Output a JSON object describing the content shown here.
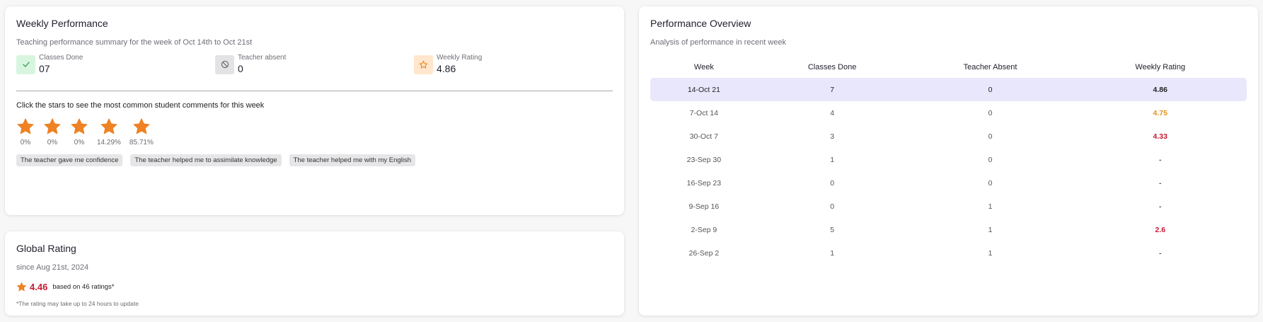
{
  "weekly": {
    "title": "Weekly Performance",
    "subtitle": "Teaching performance summary for the week of Oct 14th to Oct 21st",
    "stats": [
      {
        "label": "Classes Done",
        "value": "07",
        "icon": "check-icon",
        "color": "#3da35a"
      },
      {
        "label": "Teacher absent",
        "value": "0",
        "icon": "absent-icon",
        "color": "#666666"
      },
      {
        "label": "Weekly Rating",
        "value": "4.86",
        "icon": "star-outline-icon",
        "color": "#e3811f"
      }
    ],
    "stars_hint": "Click the stars to see the most common student comments for this week",
    "stars": [
      {
        "percent": "0%"
      },
      {
        "percent": "0%"
      },
      {
        "percent": "0%"
      },
      {
        "percent": "14.29%"
      },
      {
        "percent": "85.71%"
      }
    ],
    "star_color": "#ee8224",
    "comments": [
      "The teacher gave me confidence",
      "The teacher helped me to assimilate knowledge",
      "The teacher helped me with my English"
    ]
  },
  "global": {
    "title": "Global Rating",
    "subtitle": "since Aug 21st, 2024",
    "rating": "4.46",
    "based_on": "based on 46 ratings*",
    "note": "*The rating may take up to 24 hours to update",
    "rating_color": "#c61a35"
  },
  "overview": {
    "title": "Performance Overview",
    "subtitle": "Analysis of performance in recent week",
    "headers": [
      "Week",
      "Classes Done",
      "Teacher Absent",
      "Weekly Rating"
    ],
    "rows": [
      {
        "week": "14-Oct 21",
        "classes": "7",
        "absent": "0",
        "rating": "4.86",
        "rating_color": "#222222"
      },
      {
        "week": "7-Oct 14",
        "classes": "4",
        "absent": "0",
        "rating": "4.75",
        "rating_color": "#e3901f"
      },
      {
        "week": "30-Oct 7",
        "classes": "3",
        "absent": "0",
        "rating": "4.33",
        "rating_color": "#c61a35"
      },
      {
        "week": "23-Sep 30",
        "classes": "1",
        "absent": "0",
        "rating": "-",
        "rating_color": "#555555"
      },
      {
        "week": "16-Sep 23",
        "classes": "0",
        "absent": "0",
        "rating": "-",
        "rating_color": "#555555"
      },
      {
        "week": "9-Sep 16",
        "classes": "0",
        "absent": "1",
        "rating": "-",
        "rating_color": "#555555"
      },
      {
        "week": "2-Sep 9",
        "classes": "5",
        "absent": "1",
        "rating": "2.6",
        "rating_color": "#c61a35"
      },
      {
        "week": "26-Sep 2",
        "classes": "1",
        "absent": "1",
        "rating": "-",
        "rating_color": "#555555"
      }
    ],
    "active_color": "#e9e7fb"
  }
}
